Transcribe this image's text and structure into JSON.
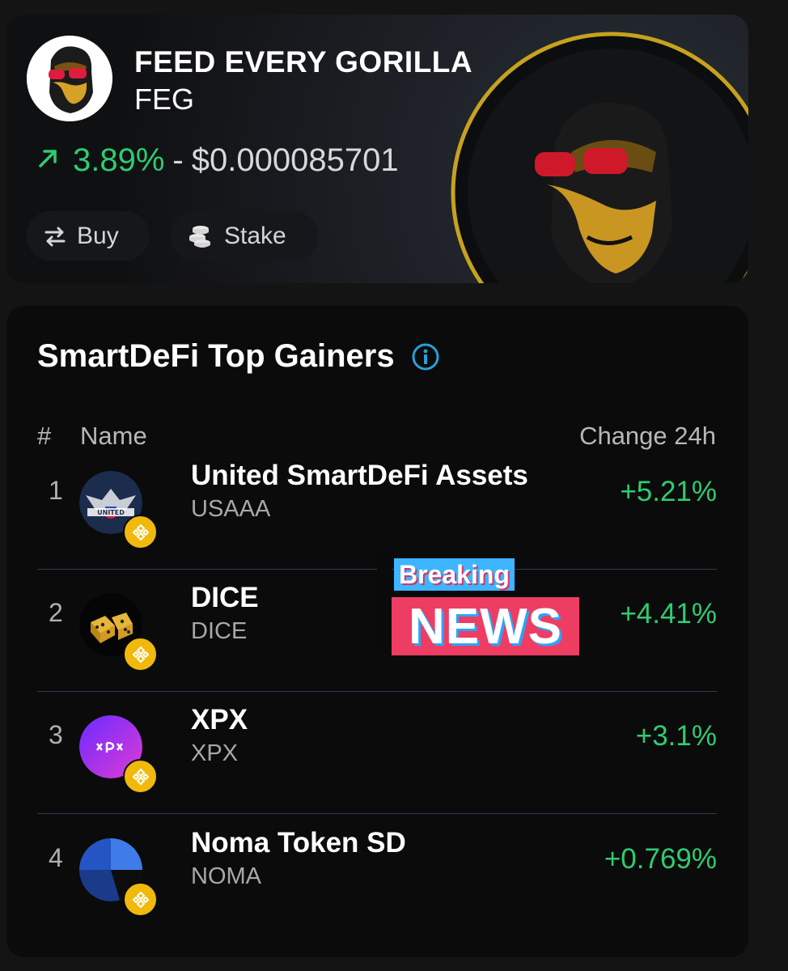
{
  "token": {
    "name": "FEED EVERY GORILLA",
    "symbol": "FEG",
    "change": "3.89%",
    "separator": "-",
    "price": "$0.000085701",
    "actions": {
      "buy": "Buy",
      "stake": "Stake"
    },
    "colors": {
      "positive": "#2ecc71"
    }
  },
  "gainers": {
    "title": "SmartDeFi Top Gainers",
    "columns": {
      "rank": "#",
      "name": "Name",
      "change": "Change 24h"
    },
    "rows": [
      {
        "rank": "1",
        "name": "United SmartDeFi Assets",
        "symbol": "USAAA",
        "change": "+5.21%",
        "icon": "usaaa-eagle-logo"
      },
      {
        "rank": "2",
        "name": "DICE",
        "symbol": "DICE",
        "change": "+4.41%",
        "icon": "dice-logo"
      },
      {
        "rank": "3",
        "name": "XPX",
        "symbol": "XPX",
        "change": "+3.1%",
        "icon": "xpx-logo"
      },
      {
        "rank": "4",
        "name": "Noma Token SD",
        "symbol": "NOMA",
        "change": "+0.769%",
        "icon": "noma-logo"
      }
    ]
  },
  "overlay": {
    "top": "Breaking",
    "bottom": "NEWS"
  }
}
